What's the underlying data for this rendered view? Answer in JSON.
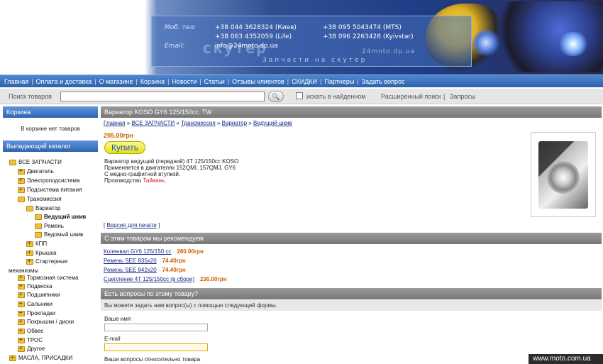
{
  "header": {
    "phone_label": "Моб. тел:",
    "email_label": "Email:",
    "phones": [
      "+38 044 3628324 (Киев)",
      "+38 095 5043474 (MTS)",
      "+38 063 4352059 (Life)",
      "+38 096 2263428 (Kyivstar)"
    ],
    "email": "info@24moto.dp.ua",
    "logo": "скутер",
    "tagline": "Запчасти на скутер",
    "site_url": "24moto.dp.ua"
  },
  "nav": [
    "Главная",
    "Оплата и доставка",
    "О магазине",
    "Корзина",
    "Новости",
    "Статьи",
    "Отзывы клиентов",
    "СКИДКИ",
    "Партнеры",
    "Задать вопрос"
  ],
  "search": {
    "label": "Поиск товаров",
    "button": "🔍",
    "checkbox_label": "искать в найденном",
    "advanced": "Расширенный поиск",
    "separator": "|",
    "queries": "Запросы"
  },
  "sidebar": {
    "cart_title": "Корзина",
    "cart_empty": "В корзине нет товаров",
    "catalog_title": "Выпадающий каталог",
    "tree": [
      "ВСЕ ЗАПЧАСТИ",
      "Двигатель",
      "Электроподсистема",
      "Подсистема питания",
      "Трансмиссия",
      "Вариатор",
      "Ведущий шкив",
      "Ремень",
      "Ведомый шкив",
      "КПП",
      "Крышка",
      "Стартерные",
      "механизмы",
      "Тормозная система",
      "Подвеска",
      "Подшипники",
      "Сальники",
      "Прокладки",
      "Покрышки / диски",
      "Обвес",
      "ТРОС",
      "Другое",
      "МАСЛА, ПРИСАДКИ"
    ]
  },
  "product": {
    "title": "Вариатор KOSO GY6 125/150cc. TW",
    "breadcrumb": [
      "Главная",
      "ВСЕ ЗАПЧАСТИ",
      "Трансмиссия",
      "Вариатор",
      "Ведущий шкив"
    ],
    "crumb_sep": "»",
    "price": "295.00грн",
    "buy": "Купить",
    "desc": [
      "Вариатор ведущий (передний) 4T 125/150cc KOSO",
      "Применяется в двигателях 152QMI, 157QMJ, GY6",
      "С медно-графитной втулкой."
    ],
    "origin_label": "Производство",
    "origin": "Тайвань.",
    "print_open": "[",
    "print_link": "Версия для печати",
    "print_close": "]"
  },
  "recommend": {
    "title": "С этим товаром мы рекомендуем",
    "items": [
      {
        "name": "Коленвал GY6 125/150 cc",
        "price": "280.00грн"
      },
      {
        "name": "Ремень SEE 835x20",
        "price": "74.40грн"
      },
      {
        "name": "Ремень SEE 842x20",
        "price": "74.40грн"
      },
      {
        "name": "Сцепление 4T 125/150cc (в сборе)",
        "price": "230.00грн"
      }
    ]
  },
  "question": {
    "title": "Есть вопросы по этому товару?",
    "intro": "Вы можете задать нам вопрос(ы) с помощью следующей формы.",
    "name_label": "Ваше имя",
    "email_label": "E-mail",
    "question_label": "Ваши вопросы относительно товара"
  },
  "watermark": "www.moto.com.ua"
}
